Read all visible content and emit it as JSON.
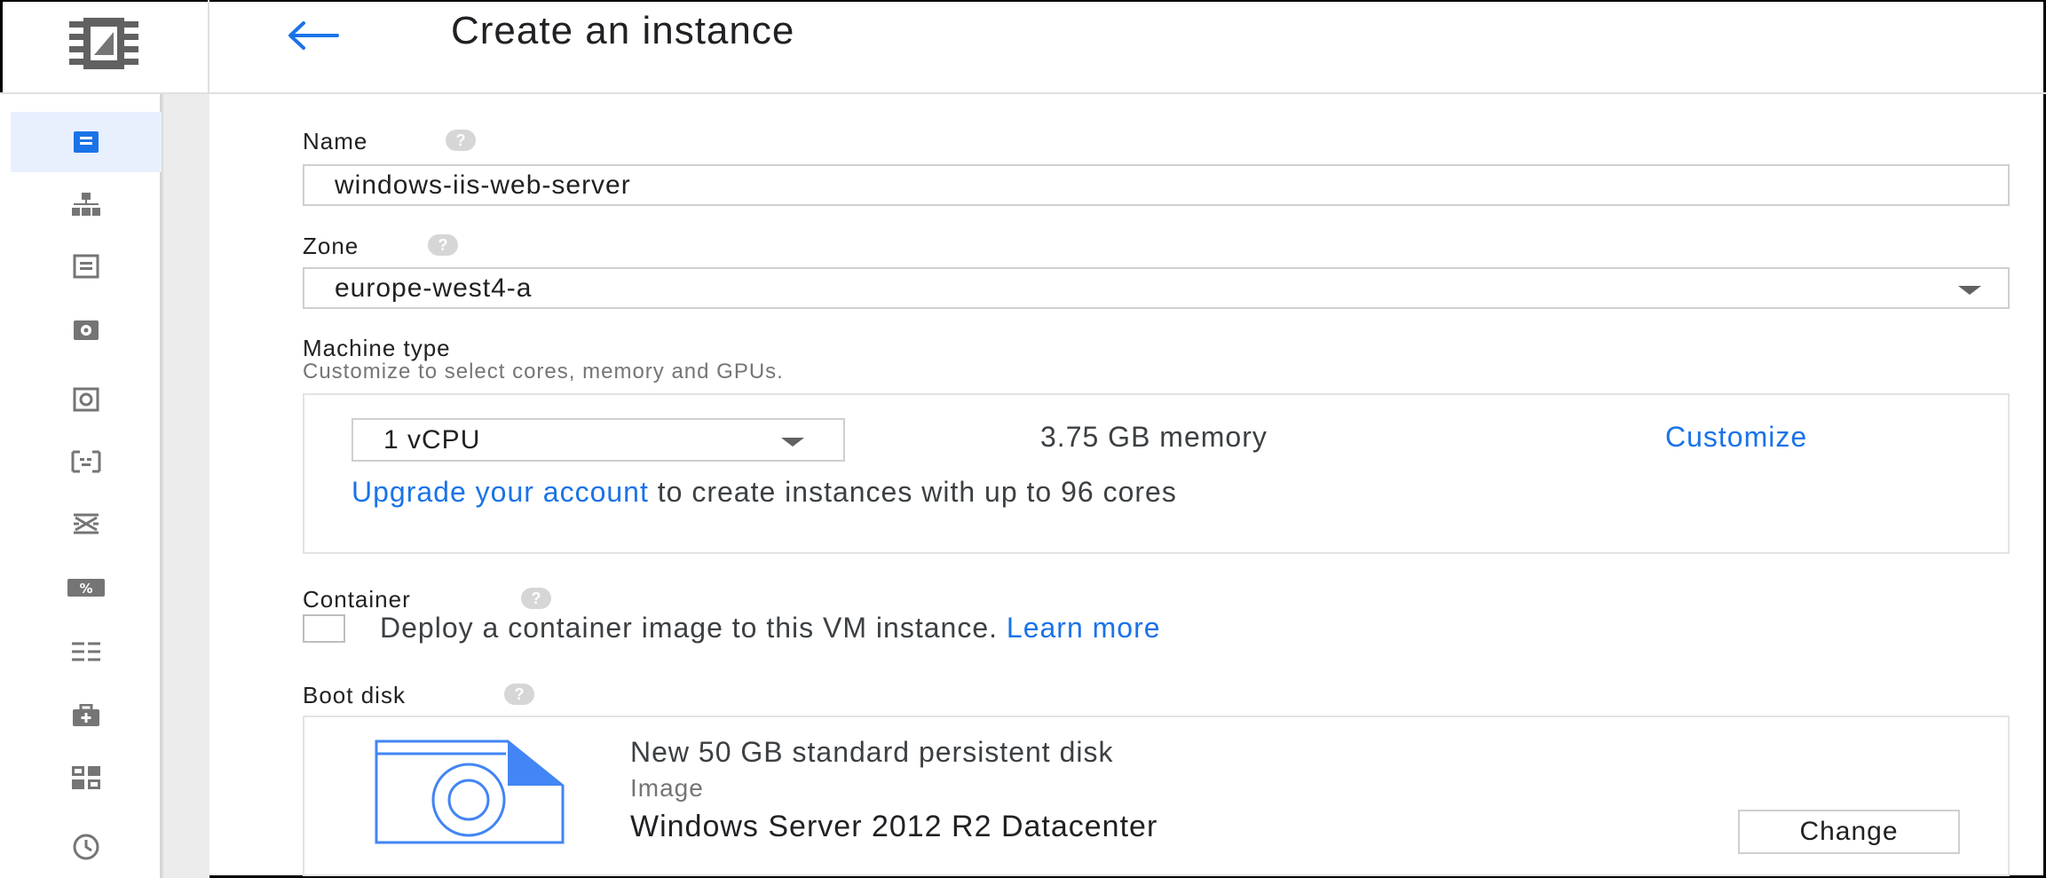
{
  "header": {
    "title": "Create an instance"
  },
  "sidebar": {
    "items": [
      {
        "icon": "vm-instances-icon"
      },
      {
        "icon": "instance-groups-icon"
      },
      {
        "icon": "instance-templates-icon"
      },
      {
        "icon": "disks-icon"
      },
      {
        "icon": "snapshots-icon"
      },
      {
        "icon": "images-icon"
      },
      {
        "icon": "tpus-icon"
      },
      {
        "icon": "committed-use-discounts-icon"
      },
      {
        "icon": "metadata-icon"
      },
      {
        "icon": "health-checks-icon"
      },
      {
        "icon": "zones-icon"
      },
      {
        "icon": "operations-icon"
      }
    ],
    "active_index": 0
  },
  "form": {
    "name": {
      "label": "Name",
      "value": "windows-iis-web-server"
    },
    "zone": {
      "label": "Zone",
      "value": "europe-west4-a"
    },
    "machine_type": {
      "label": "Machine type",
      "hint": "Customize to select cores, memory and GPUs.",
      "cores_value": "1 vCPU",
      "memory": "3.75 GB memory",
      "customize_link": "Customize",
      "upgrade_link": "Upgrade your account",
      "upgrade_text": " to create instances with up to 96 cores"
    },
    "container": {
      "label": "Container",
      "checkbox_text": "Deploy a container image to this VM instance.",
      "learn_more": "Learn more",
      "checked": false
    },
    "boot_disk": {
      "label": "Boot disk",
      "disk_desc": "New 50 GB standard persistent disk",
      "image_label": "Image",
      "image_name": "Windows Server 2012 R2 Datacenter",
      "change_button": "Change"
    },
    "help_symbol": "?"
  },
  "colors": {
    "link": "#1a73e8",
    "disk_icon": "#4285f4",
    "active_nav_bg": "#e8f0fe"
  }
}
